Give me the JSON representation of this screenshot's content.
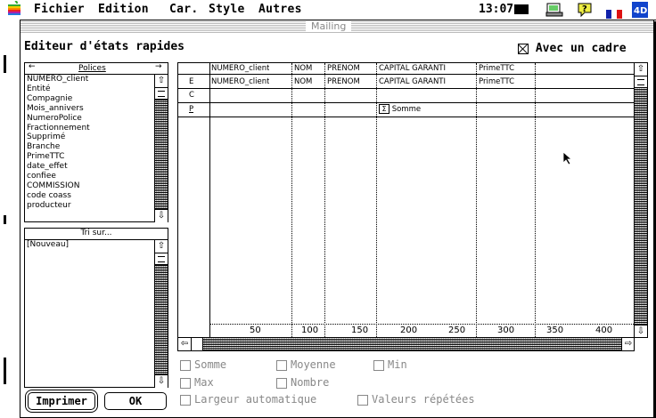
{
  "menubar": {
    "items": [
      "Fichier",
      "Edition",
      "Car.",
      "Style",
      "Autres"
    ],
    "clock": "13:07"
  },
  "window": {
    "title": "Mailing",
    "heading": "Editeur d'états rapides",
    "frame_option": "Avec un cadre"
  },
  "fields_panel": {
    "header": "Polices",
    "items": [
      "NUMERO_client",
      "Entité",
      "Compagnie",
      "Mois_annivers",
      "NumeroPolice",
      "Fractionnement",
      "Supprimé",
      "Branche",
      "PrimeTTC",
      "date_effet",
      "confiee",
      "COMMISSION",
      "code coass",
      "producteur"
    ]
  },
  "sort_panel": {
    "header": "Tri sur...",
    "items": [
      "[Nouveau]"
    ]
  },
  "grid": {
    "columns": [
      "NUMERO_client",
      "NOM",
      "PRENOM",
      "CAPITAL GARANTI",
      "PrimeTTC"
    ],
    "row_labels": [
      "E",
      "C",
      "P"
    ],
    "header_row": [
      "NUMERO_client",
      "NOM",
      "PRENOM",
      "CAPITAL GARANTI",
      "PrimeTTC"
    ],
    "sum_cell": "Somme",
    "ruler": [
      "50",
      "100",
      "150",
      "200",
      "250",
      "300",
      "350",
      "400"
    ]
  },
  "options": {
    "somme": "Somme",
    "moyenne": "Moyenne",
    "min": "Min",
    "max": "Max",
    "nombre": "Nombre",
    "largeur": "Largeur automatique",
    "valeurs": "Valeurs répétées"
  },
  "buttons": {
    "print": "Imprimer",
    "ok": "OK"
  }
}
